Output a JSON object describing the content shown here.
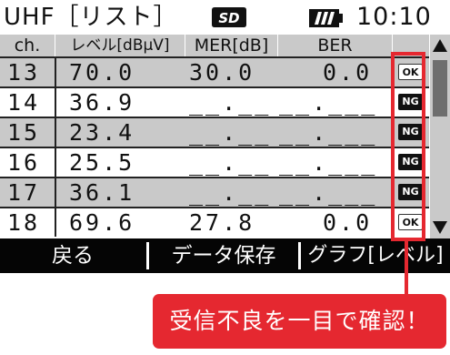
{
  "status": {
    "mode_title": "UHF［リスト］",
    "clock": "10:10",
    "sd_icon": "sd-card-icon",
    "battery_icon": "battery-icon"
  },
  "table": {
    "headers": [
      "ch.",
      "レベル[dBμV]",
      "MER[dB]",
      "BER"
    ],
    "rows": [
      {
        "ch": "13",
        "level": "70.0",
        "mer": "30.0",
        "ber": "0.0",
        "status": "OK"
      },
      {
        "ch": "14",
        "level": "36.9",
        "mer": "__.__",
        "ber": "__.___",
        "status": "NG"
      },
      {
        "ch": "15",
        "level": "23.4",
        "mer": "__.__",
        "ber": "__.___",
        "status": "NG"
      },
      {
        "ch": "16",
        "level": "25.5",
        "mer": "__.__",
        "ber": "__.___",
        "status": "NG"
      },
      {
        "ch": "17",
        "level": "36.1",
        "mer": "__.__",
        "ber": "__.___",
        "status": "NG"
      },
      {
        "ch": "18",
        "level": "69.6",
        "mer": "27.8",
        "ber": "0.0",
        "status": "OK"
      }
    ]
  },
  "softkeys": [
    "戻る",
    "データ保存",
    "グラフ[レベル]"
  ],
  "callout": {
    "text": "受信不良を一目で確認！",
    "color": "#e52830"
  }
}
